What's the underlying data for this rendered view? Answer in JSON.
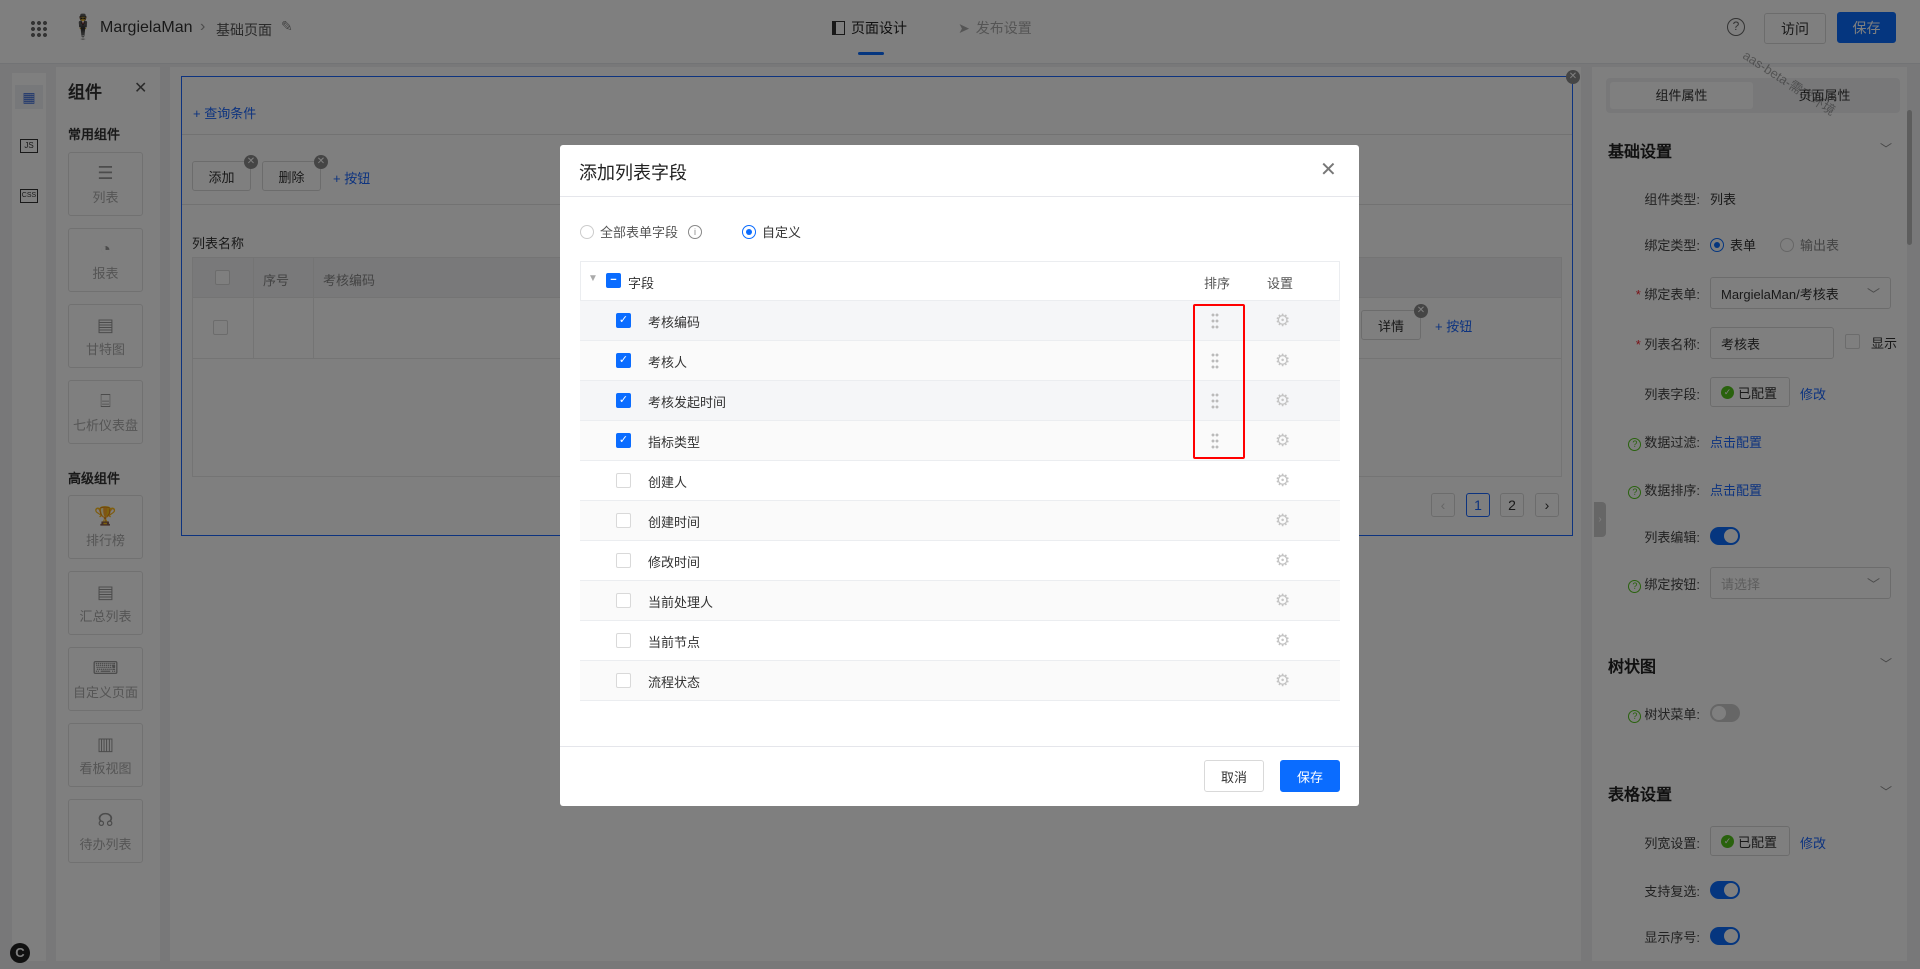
{
  "header": {
    "app_name": "MargielaMan",
    "breadcrumb_page": "基础页面",
    "tabs": [
      {
        "label": "页面设计",
        "active": true
      },
      {
        "label": "发布设置",
        "active": false
      }
    ],
    "visit_label": "访问",
    "save_label": "保存",
    "watermark": "aas-beta-需求环境"
  },
  "left_panel": {
    "title": "组件",
    "common_title": "常用组件",
    "common_items": [
      {
        "label": "列表",
        "icon": "list-icon"
      },
      {
        "label": "报表",
        "icon": "pie-chart-icon"
      },
      {
        "label": "甘特图",
        "icon": "gantt-icon"
      },
      {
        "label": "七析仪表盘",
        "icon": "dashboard-icon"
      }
    ],
    "advanced_title": "高级组件",
    "advanced_items": [
      {
        "label": "排行榜",
        "icon": "trophy-icon"
      },
      {
        "label": "汇总列表",
        "icon": "summary-list-icon"
      },
      {
        "label": "自定义页面",
        "icon": "terminal-icon"
      },
      {
        "label": "看板视图",
        "icon": "kanban-icon"
      },
      {
        "label": "待办列表",
        "icon": "org-tree-icon"
      }
    ],
    "rail_icons": [
      "components-icon",
      "js-icon",
      "css-icon"
    ]
  },
  "canvas": {
    "add_query": "+ 查询条件",
    "buttons": [
      "添加",
      "删除"
    ],
    "add_button": "+ 按钮",
    "list_title": "列表名称",
    "columns": [
      "序号",
      "考核编码"
    ],
    "row_action": "详情",
    "pagination": {
      "pages": [
        "1",
        "2"
      ],
      "current": 1
    }
  },
  "right_panel": {
    "tabs": [
      "组件属性",
      "页面属性"
    ],
    "basic": {
      "title": "基础设置",
      "component_type_label": "组件类型:",
      "component_type": "列表",
      "bind_type_label": "绑定类型:",
      "bind_type_options": [
        "表单",
        "输出表"
      ],
      "bind_type_selected": "表单",
      "bind_form_label": "绑定表单:",
      "bind_form_value": "MargielaMan/考核表",
      "list_name_label": "列表名称:",
      "list_name_value": "考核表",
      "show_label": "显示",
      "list_fields_label": "列表字段:",
      "configured": "已配置",
      "modify": "修改",
      "data_filter_label": "数据过滤:",
      "click_config": "点击配置",
      "data_sort_label": "数据排序:",
      "list_edit_label": "列表编辑:",
      "list_edit_on": true,
      "bind_button_label": "绑定按钮:",
      "bind_button_placeholder": "请选择"
    },
    "tree": {
      "title": "树状图",
      "tree_menu_label": "树状菜单:",
      "tree_menu_on": false
    },
    "table": {
      "title": "表格设置",
      "col_width_label": "列宽设置:",
      "configured": "已配置",
      "modify": "修改",
      "multi_select_label": "支持复选:",
      "multi_select_on": true,
      "show_index_label": "显示序号:",
      "show_index_on": true
    }
  },
  "dialog": {
    "title": "添加列表字段",
    "radio_all": "全部表单字段",
    "radio_custom": "自定义",
    "radio_selected": "自定义",
    "col_field": "字段",
    "col_sort": "排序",
    "col_settings": "设置",
    "fields": [
      {
        "name": "考核编码",
        "checked": true
      },
      {
        "name": "考核人",
        "checked": true
      },
      {
        "name": "考核发起时间",
        "checked": true
      },
      {
        "name": "指标类型",
        "checked": true
      },
      {
        "name": "创建人",
        "checked": false
      },
      {
        "name": "创建时间",
        "checked": false
      },
      {
        "name": "修改时间",
        "checked": false
      },
      {
        "name": "当前处理人",
        "checked": false
      },
      {
        "name": "当前节点",
        "checked": false
      },
      {
        "name": "流程状态",
        "checked": false
      }
    ],
    "cancel_label": "取消",
    "save_label": "保存",
    "highlight_color": "#ff0000"
  }
}
